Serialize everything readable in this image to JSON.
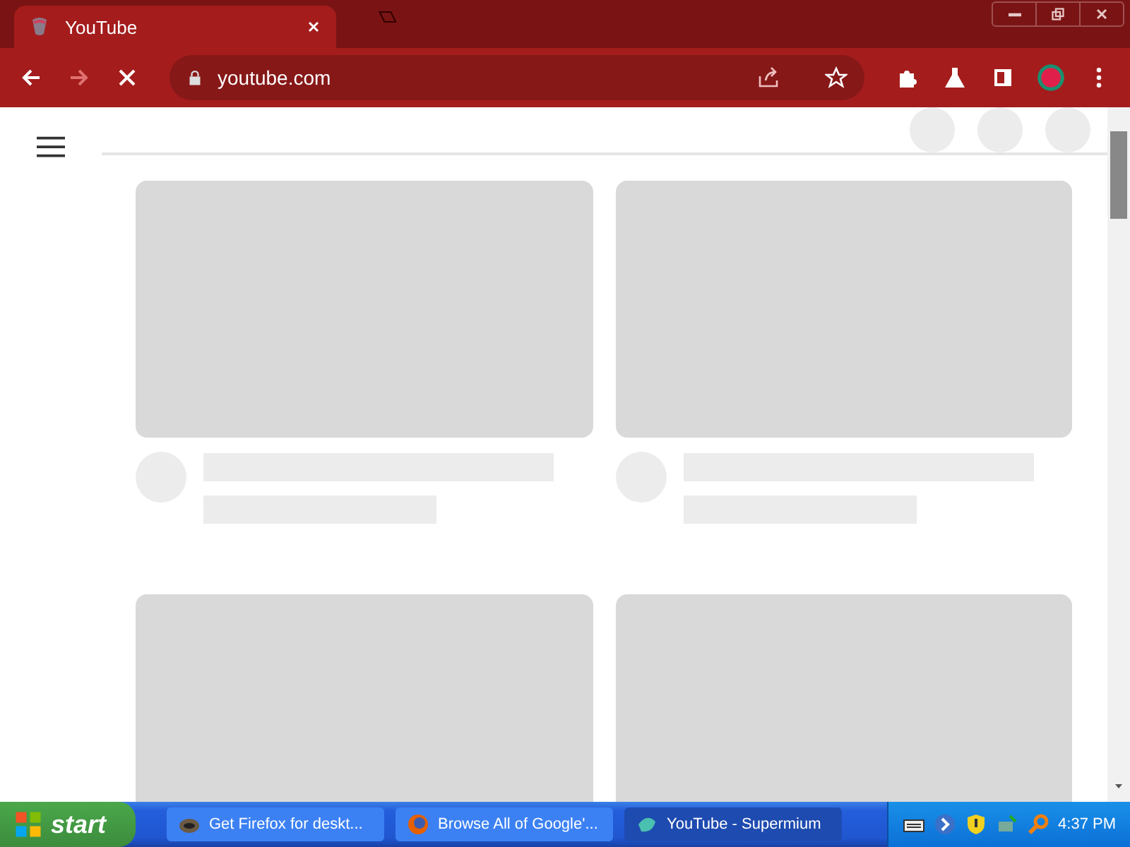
{
  "browser": {
    "tabs": [
      {
        "title": "YouTube",
        "selected": true
      }
    ],
    "address": "youtube.com",
    "forward_disabled": true
  },
  "taskbar": {
    "start": "start",
    "buttons": [
      {
        "label": "Get Firefox for deskt...",
        "selected": false
      },
      {
        "label": "Browse All of Google'...",
        "selected": false
      },
      {
        "label": "YouTube - Supermium",
        "selected": true
      }
    ],
    "clock": "4:37 PM"
  }
}
